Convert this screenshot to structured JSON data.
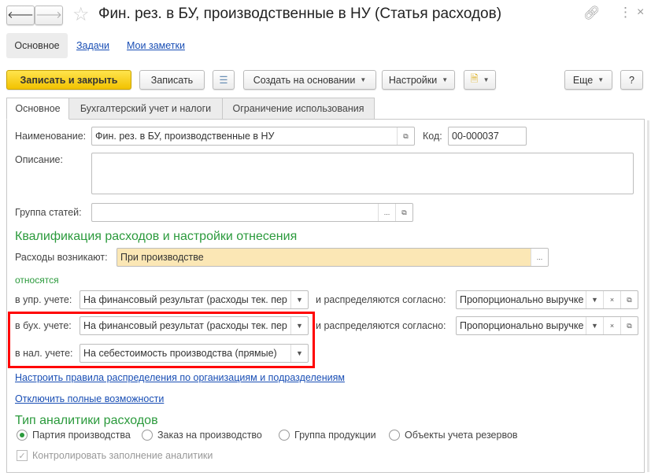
{
  "window": {
    "title": "Фин. рез. в БУ, производственные в НУ (Статья расходов)"
  },
  "nav": {
    "items": [
      "Основное",
      "Задачи",
      "Мои заметки"
    ]
  },
  "toolbar": {
    "save_close": "Записать и закрыть",
    "save": "Записать",
    "create_based": "Создать на основании",
    "settings": "Настройки",
    "more": "Еще",
    "help": "?"
  },
  "tabs": [
    "Основное",
    "Бухгалтерский учет и налоги",
    "Ограничение использования"
  ],
  "form": {
    "name_label": "Наименование:",
    "name_value": "Фин. рез. в БУ, производственные в НУ",
    "code_label": "Код:",
    "code_value": "00-000037",
    "desc_label": "Описание:",
    "desc_value": "",
    "group_label": "Группа статей:",
    "group_value": "",
    "qual_heading": "Квалификация расходов и настройки отнесения",
    "arise_label": "Расходы возникают:",
    "arise_value": "При производстве",
    "relate_label": "относятся",
    "rows": [
      {
        "label": "в упр. учете:",
        "value": "На финансовый результат (расходы тек. пер",
        "dist_label": "и распределяются согласно:",
        "dist_value": "Пропорционально выручке"
      },
      {
        "label": "в бух. учете:",
        "value": "На финансовый результат (расходы тек. пер",
        "dist_label": "и распределяются согласно:",
        "dist_value": "Пропорционально выручке"
      },
      {
        "label": "в нал. учете:",
        "value": "На себестоимость производства (прямые)"
      }
    ],
    "link_rules": "Настроить правила распределения по организациям и подразделениям",
    "link_disable": "Отключить полные возможности",
    "analytics_heading": "Тип аналитики расходов",
    "radios": [
      "Партия производства",
      "Заказ на производство",
      "Группа продукции",
      "Объекты учета резервов"
    ],
    "selected_radio": 0,
    "check_label": "Контролировать заполнение аналитики",
    "check_value": true
  },
  "colors": {
    "accent_green": "#2b9a3c",
    "highlight": "#ff0000",
    "primary": "#f2c200"
  }
}
